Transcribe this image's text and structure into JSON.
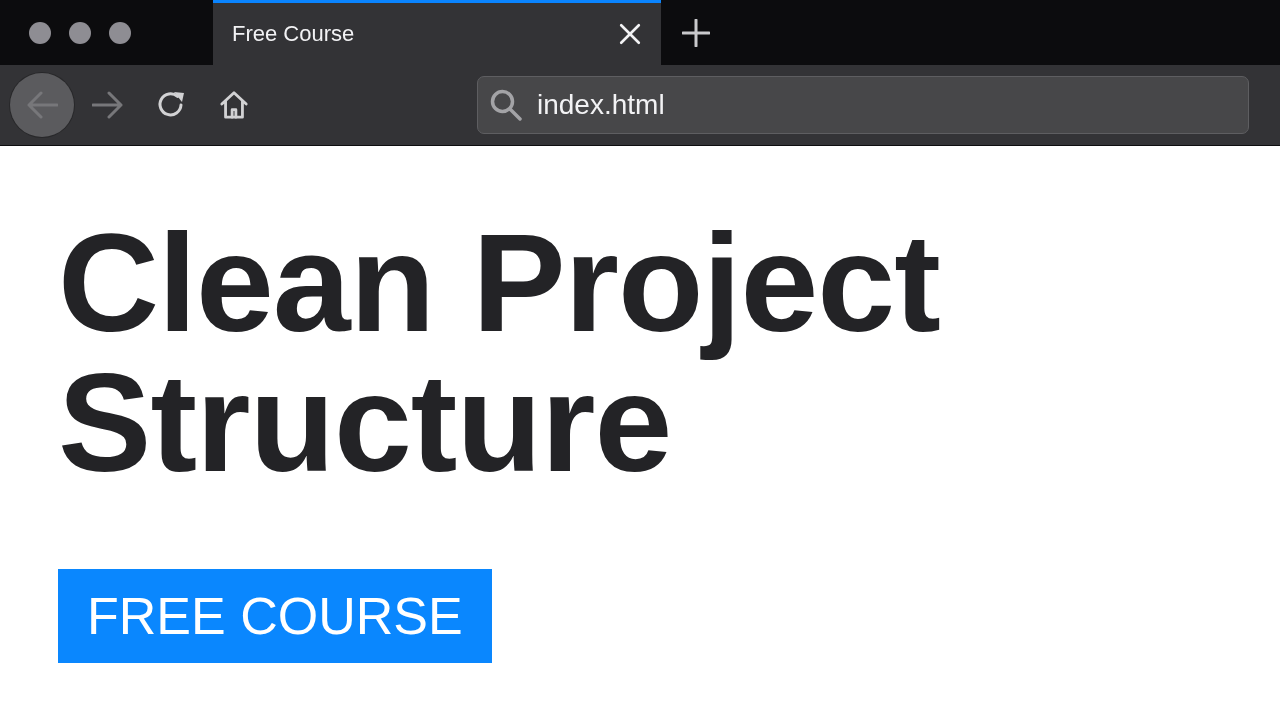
{
  "tabs": [
    {
      "label": "Free Course",
      "selected": true
    }
  ],
  "nav_buttons": [
    {
      "kind": "back",
      "disabled": true,
      "highlighted": true
    },
    {
      "kind": "forward",
      "disabled": true,
      "highlighted": false
    },
    {
      "kind": "reload",
      "disabled": false,
      "highlighted": false
    },
    {
      "kind": "home",
      "disabled": false,
      "highlighted": false
    }
  ],
  "address_bar": {
    "value": "index.html"
  },
  "page": {
    "heading": "Clean Project Structure",
    "button": "FREE COURSE"
  }
}
